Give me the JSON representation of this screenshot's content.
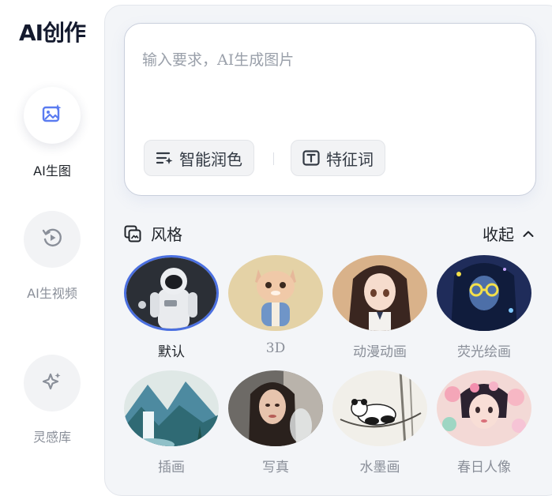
{
  "brand": {
    "title": "AI创作"
  },
  "nav": {
    "items": [
      {
        "label": "AI生图",
        "icon": "image-sparkle-icon",
        "active": true
      },
      {
        "label": "AI生视频",
        "icon": "video-replay-icon",
        "active": false
      },
      {
        "label": "灵感库",
        "icon": "sparkle-icon",
        "active": false
      }
    ]
  },
  "prompt": {
    "placeholder": "输入要求，AI生成图片",
    "value": "",
    "polish_label": "智能润色",
    "keywords_label": "特征词"
  },
  "styles": {
    "title": "风格",
    "collapse_label": "收起",
    "items": [
      {
        "label": "默认",
        "subject": "astronaut",
        "selected": true
      },
      {
        "label": "3D",
        "subject": "3d-cat-character",
        "selected": false
      },
      {
        "label": "动漫动画",
        "subject": "anime-girl",
        "selected": false
      },
      {
        "label": "荧光绘画",
        "subject": "neon-glasses-girl",
        "selected": false
      },
      {
        "label": "插画",
        "subject": "landscape-waterfall",
        "selected": false
      },
      {
        "label": "写真",
        "subject": "portrait-woman",
        "selected": false
      },
      {
        "label": "水墨画",
        "subject": "ink-panda",
        "selected": false
      },
      {
        "label": "春日人像",
        "subject": "spring-flower-girl",
        "selected": false
      }
    ]
  },
  "colors": {
    "accent": "#4a6fe0",
    "panel_bg": "#f3f5f8"
  }
}
